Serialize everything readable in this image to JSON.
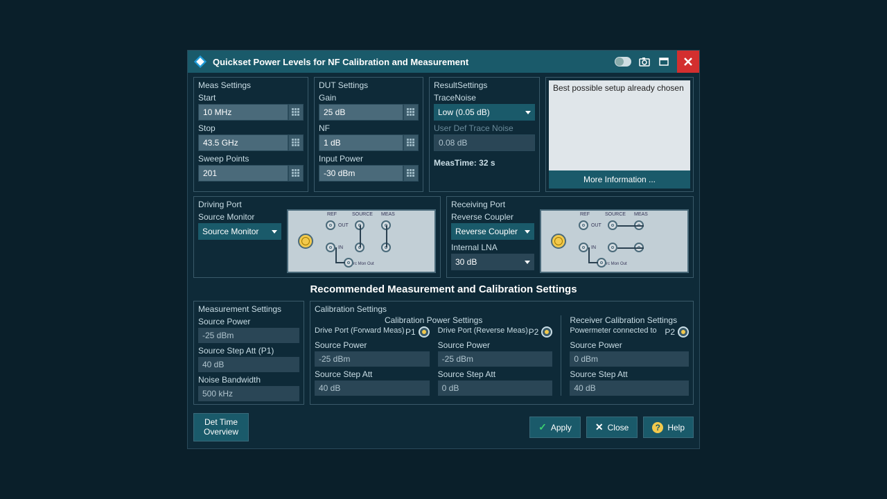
{
  "window": {
    "title": "Quickset Power Levels for NF Calibration and Measurement"
  },
  "meas": {
    "title": "Meas Settings",
    "start_label": "Start",
    "start": "10 MHz",
    "stop_label": "Stop",
    "stop": "43.5 GHz",
    "sweep_label": "Sweep Points",
    "sweep": "201"
  },
  "dut": {
    "title": "DUT Settings",
    "gain_label": "Gain",
    "gain": "25 dB",
    "nf_label": "NF",
    "nf": "1 dB",
    "power_label": "Input Power",
    "power": "-30 dBm"
  },
  "result": {
    "title": "ResultSettings",
    "tn_label": "TraceNoise",
    "tn": "Low (0.05 dB)",
    "udtn_label": "User Def Trace Noise",
    "udtn": "0.08 dB",
    "meastime": "MeasTime: 32 s"
  },
  "info": {
    "text": "Best possible setup already chosen",
    "more": "More Information ..."
  },
  "driving": {
    "title": "Driving Port",
    "sm_label": "Source Monitor",
    "sm": "Source Monitor"
  },
  "receiving": {
    "title": "Receiving Port",
    "rc_label": "Reverse Coupler",
    "rc": "Reverse Coupler",
    "lna_label": "Internal LNA",
    "lna": "30 dB"
  },
  "rec_heading": "Recommended Measurement and Calibration Settings",
  "ms": {
    "title": "Measurement Settings",
    "sp_label": "Source Power",
    "sp": "-25 dBm",
    "ssa_label": "Source Step Att (P1)",
    "ssa": "40 dB",
    "nbw_label": "Noise Bandwidth",
    "nbw": "500 kHz"
  },
  "cal": {
    "title": "Calibration Settings",
    "cps_title": "Calibration Power Settings",
    "rcs_title": "Receiver Calibration Settings",
    "p1": "P1",
    "p2": "P2",
    "col1": {
      "sub": "Drive Port (Forward Meas)",
      "sp_label": "Source Power",
      "sp": "-25 dBm",
      "ssa_label": "Source Step Att",
      "ssa": "40 dB"
    },
    "col2": {
      "sub": "Drive Port (Reverse Meas)",
      "sp_label": "Source Power",
      "sp": "-25 dBm",
      "ssa_label": "Source Step Att",
      "ssa": "0 dB"
    },
    "col3": {
      "sub": "Powermeter connected to",
      "sp_label": "Source Power",
      "sp": "0 dBm",
      "ssa_label": "Source Step Att",
      "ssa": "40 dB"
    }
  },
  "btns": {
    "det": "Det Time Overview",
    "apply": "Apply",
    "close": "Close",
    "help": "Help"
  },
  "diag": {
    "ref": "REF",
    "source": "SOURCE",
    "meas": "MEAS",
    "out": "OUT",
    "in": "IN",
    "smo": "Src Mon Out"
  }
}
